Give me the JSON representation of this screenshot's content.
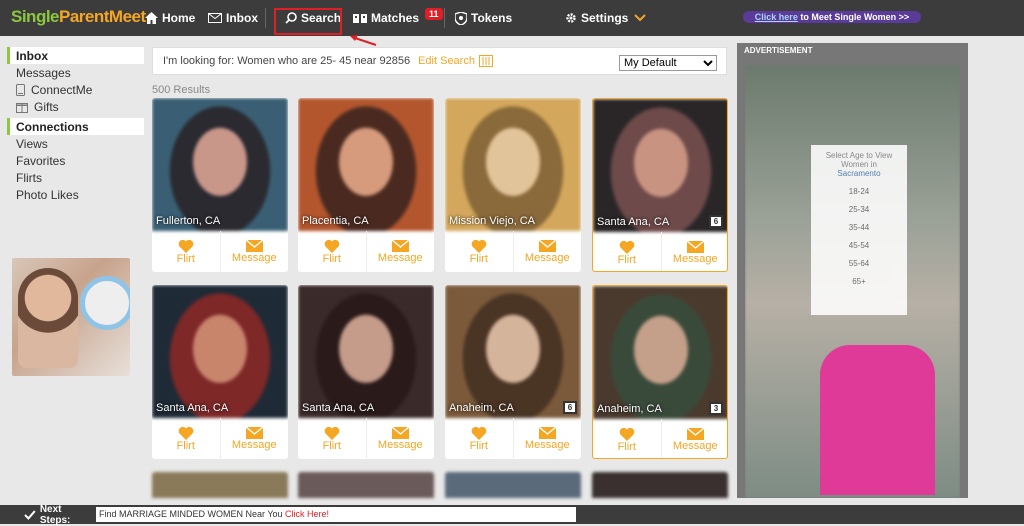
{
  "logo": {
    "part1": "Single",
    "part2": "ParentMeet"
  },
  "nav": {
    "home": "Home",
    "inbox": "Inbox",
    "search": "Search",
    "matches": "Matches",
    "matches_badge": "11",
    "tokens": "Tokens",
    "settings": "Settings"
  },
  "promo": {
    "link": "Click here",
    "text": " to Meet Single Women >>"
  },
  "sidebar": {
    "inbox_head": "Inbox",
    "items1": [
      "Messages",
      "ConnectMe",
      "Gifts"
    ],
    "connections_head": "Connections",
    "items2": [
      "Views",
      "Favorites",
      "Flirts",
      "Photo Likes"
    ]
  },
  "filter": {
    "label": "I'm looking for: Women who are 25- 45 near 92856",
    "edit": "Edit Search",
    "select_value": "My Default"
  },
  "results_count": "500 Results",
  "profiles": [
    {
      "loc": "Fullerton, CA",
      "count": "",
      "hl": false,
      "colors": [
        "#3a5f74",
        "#c9978a",
        "#2a2a30"
      ]
    },
    {
      "loc": "Placentia, CA",
      "count": "",
      "hl": false,
      "colors": [
        "#b3562e",
        "#d69a7c",
        "#4a2a20"
      ]
    },
    {
      "loc": "Mission Viejo, CA",
      "count": "",
      "hl": false,
      "colors": [
        "#d4a85c",
        "#e2c49a",
        "#8a6a3a"
      ]
    },
    {
      "loc": "Santa Ana, CA",
      "count": "6",
      "hl": true,
      "colors": [
        "#2a2628",
        "#c89481",
        "#6e4a4a"
      ]
    },
    {
      "loc": "Santa Ana, CA",
      "count": "",
      "hl": false,
      "colors": [
        "#1e2a36",
        "#c9856c",
        "#7e2828"
      ]
    },
    {
      "loc": "Santa Ana, CA",
      "count": "",
      "hl": false,
      "colors": [
        "#3a2a2a",
        "#c59b8a",
        "#2a1a1a"
      ]
    },
    {
      "loc": "Anaheim, CA",
      "count": "6",
      "hl": false,
      "colors": [
        "#7a5a3a",
        "#d4b49a",
        "#4a3424"
      ]
    },
    {
      "loc": "Anaheim, CA",
      "count": "3",
      "hl": true,
      "colors": [
        "#4a3a2e",
        "#c4a08a",
        "#3a4a3a"
      ]
    }
  ],
  "actions": {
    "flirt": "Flirt",
    "message": "Message"
  },
  "ad": {
    "title": "ADVERTISEMENT",
    "box_title": "Select Age to View Women in",
    "box_city": "Sacramento",
    "ages": [
      "18-24",
      "25-34",
      "35-44",
      "45-54",
      "55-64",
      "65+"
    ]
  },
  "bottom": {
    "label": "Next Steps:",
    "text": "Find MARRIAGE MINDED WOMEN Near You ",
    "link": "Click Here!"
  },
  "icons": {
    "home": "home-icon",
    "inbox": "envelope-icon",
    "search": "search-icon",
    "matches": "matches-icon",
    "tokens": "shield-icon",
    "settings": "gear-icon",
    "flirt": "heart-icon",
    "message": "envelope-icon",
    "connectme": "phone-icon",
    "gifts": "gift-icon",
    "check": "check-icon"
  },
  "colors": {
    "accent": "#f5a623",
    "brand_green": "#8dc63f",
    "topbar": "#3c3c3c",
    "alert_red": "#e01e26"
  }
}
